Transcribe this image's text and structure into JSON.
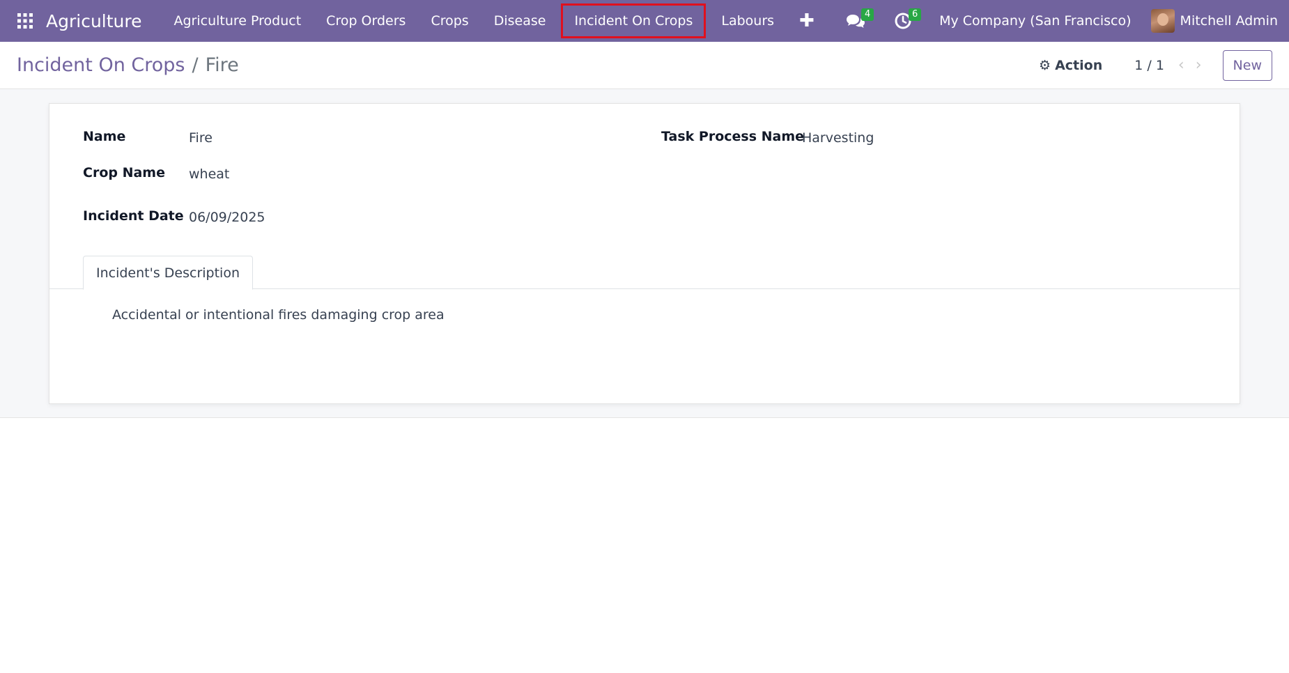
{
  "navbar": {
    "brand": "Agriculture",
    "menu": [
      {
        "label": "Agriculture Product"
      },
      {
        "label": "Crop Orders"
      },
      {
        "label": "Crops"
      },
      {
        "label": "Disease"
      },
      {
        "label": "Incident On Crops"
      },
      {
        "label": "Labours"
      }
    ],
    "messages_count": "4",
    "activities_count": "6",
    "company": "My Company (San Francisco)",
    "user": "Mitchell Admin"
  },
  "control_panel": {
    "breadcrumb_parent": "Incident On Crops",
    "breadcrumb_separator": "/",
    "breadcrumb_current": "Fire",
    "action_label": "Action",
    "pager": "1 / 1",
    "new_label": "New"
  },
  "form": {
    "name_label": "Name",
    "name_value": "Fire",
    "crop_label": "Crop Name",
    "crop_value": "wheat",
    "date_label": "Incident Date",
    "date_value": "06/09/2025",
    "task_label": "Task Process Name",
    "task_value": "Harvesting",
    "tab_label": "Incident's Description",
    "description": "Accidental or intentional fires damaging crop area"
  },
  "colors": {
    "brand": "#71639e",
    "badge": "#28a745",
    "highlight": "#e0101e"
  }
}
